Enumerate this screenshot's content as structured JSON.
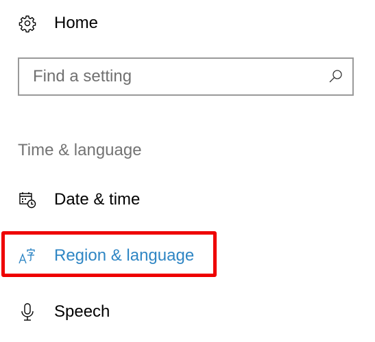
{
  "nav": {
    "home": {
      "label": "Home",
      "icon": "gear-icon"
    }
  },
  "search": {
    "placeholder": "Find a setting",
    "value": "",
    "icon": "search-icon"
  },
  "section": {
    "title": "Time & language",
    "items": [
      {
        "label": "Date & time",
        "icon": "calendar-clock-icon",
        "selected": false
      },
      {
        "label": "Region & language",
        "icon": "language-icon",
        "selected": true
      },
      {
        "label": "Speech",
        "icon": "microphone-icon",
        "selected": false
      }
    ]
  },
  "colors": {
    "accent": "#2f86c4",
    "highlight_border": "#ee0000",
    "text": "#000000",
    "muted_text": "#737373",
    "search_border": "#999999"
  }
}
